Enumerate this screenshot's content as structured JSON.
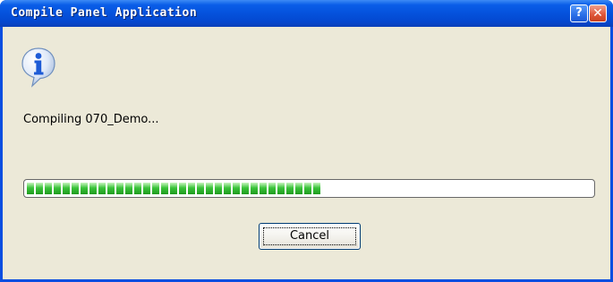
{
  "window": {
    "title": "Compile Panel Application",
    "help_label": "?",
    "close_label": "✕"
  },
  "dialog": {
    "icon": "information-icon",
    "message": "Compiling 070_Demo...",
    "progress_fraction": 0.52,
    "cancel_label": "Cancel"
  },
  "colors": {
    "title_bar": "#0553de",
    "client_background": "#ece9d8",
    "progress_green": "#3bc43b",
    "progress_border": "#686868"
  }
}
